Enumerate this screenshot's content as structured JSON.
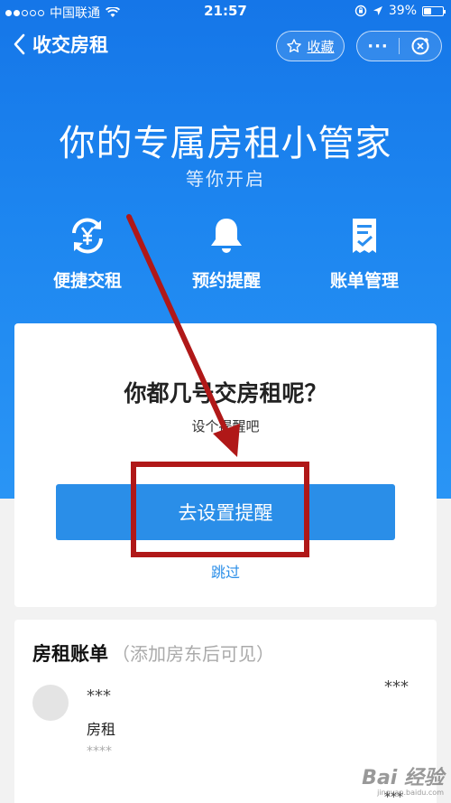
{
  "status_bar": {
    "carrier": "中国联通",
    "time": "21:57",
    "battery": "39%",
    "battery_level": 0.39
  },
  "nav": {
    "title": "收交房租",
    "favorite_label": "收藏",
    "more_label": "···"
  },
  "hero": {
    "title": "你的专属房租小管家",
    "subtitle": "等你开启"
  },
  "features": [
    {
      "label": "便捷交租",
      "icon": "yen-exchange-icon"
    },
    {
      "label": "预约提醒",
      "icon": "bell-icon"
    },
    {
      "label": "账单管理",
      "icon": "bill-check-icon"
    }
  ],
  "reminder_card": {
    "question": "你都几号交房租呢？",
    "hint": "设个提醒吧",
    "button_label": "去设置提醒",
    "skip_label": "跳过"
  },
  "bill": {
    "title": "房租账单",
    "hint": "（添加房东后可见）",
    "rows": [
      {
        "name": "***",
        "amount": "***",
        "kind": "房租",
        "date": "****"
      }
    ],
    "next_amount": "***"
  },
  "watermark": {
    "brand": "Bai 经验",
    "url": "jingyan.baidu.com"
  },
  "colors": {
    "hero_blue": "#1d86f0",
    "primary": "#2a8ee8",
    "annotation_red": "#b01818"
  }
}
